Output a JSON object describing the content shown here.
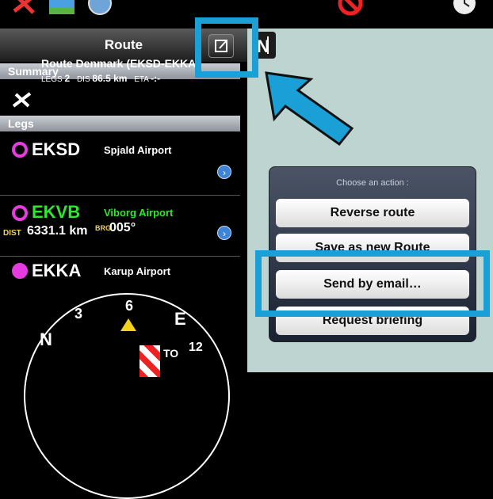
{
  "panel": {
    "title": "Route",
    "summary_header": "Summary",
    "legs_header": "Legs",
    "route": {
      "title": "Route Denmark (EKSD-EKKA)",
      "legs_label": "LEGS",
      "legs_value": "2",
      "dis_label": "DIS",
      "dis_value": "86.5 km",
      "eta_label": "ETA",
      "eta_value": "-:-"
    },
    "legs": [
      {
        "ident": "EKSD",
        "name": "Spjald Airport",
        "color": "#ffffff"
      },
      {
        "ident": "EKVB",
        "name": "Viborg Airport",
        "color": "#2ee82e",
        "dist_label": "DIST",
        "dist_value": "6331.1 km",
        "brg_label": "BRG",
        "brg_value": "005°"
      },
      {
        "ident": "EKKA",
        "name": "Karup Airport",
        "color": "#ffffff"
      }
    ]
  },
  "compass": {
    "n_label": "N",
    "e_label": "E",
    "tick_3": "3",
    "tick_6": "6",
    "tick_12": "12",
    "to_label": "TO"
  },
  "popup": {
    "title": "Choose an action :",
    "buttons": [
      "Reverse route",
      "Save as new Route",
      "Send by email…",
      "Request briefing"
    ]
  },
  "colors": {
    "highlight": "#1aa0d6",
    "leg_ring": "#e53be0",
    "info_button": "#3d83d8",
    "map_bg": "#bdd4d0"
  },
  "icons": [
    "plane-icon",
    "map-layer-icon",
    "weather-icon",
    "north-up-icon",
    "edit-icon",
    "no-entry-icon",
    "clock-icon",
    "info-chevron-icon"
  ]
}
